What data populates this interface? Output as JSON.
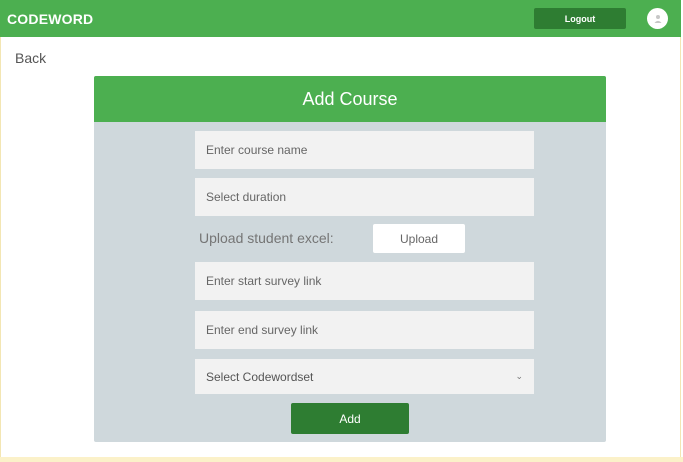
{
  "navbar": {
    "brand": "CODEWORD",
    "logout_label": "Logout",
    "avatar_icon": "user-avatar-icon",
    "color": "#4caf50"
  },
  "back_label": "Back",
  "form": {
    "title": "Add Course",
    "course_name_placeholder": "Enter course name",
    "duration_placeholder": "Select duration",
    "upload_label": "Upload student excel:",
    "upload_button": "Upload",
    "start_survey_placeholder": "Enter start survey link",
    "end_survey_placeholder": "Enter end survey link",
    "codewordset_selected": "Select Codewordset",
    "add_button": "Add",
    "chevron_icon": "chevron-down-icon"
  }
}
